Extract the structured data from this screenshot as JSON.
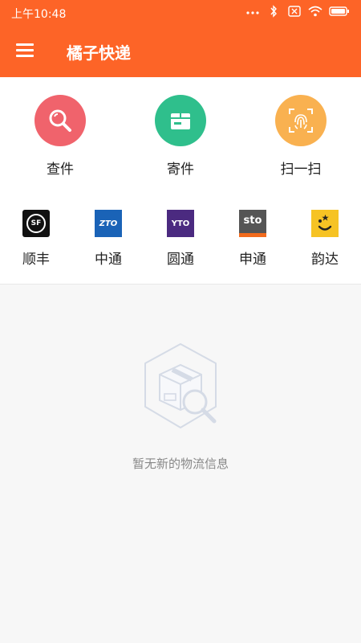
{
  "status_bar": {
    "time": "上午10:48",
    "icons": [
      "dots-icon",
      "bluetooth-icon",
      "sim-icon",
      "wifi-icon",
      "battery-icon"
    ]
  },
  "app_bar": {
    "title": "橘子快递",
    "menu_icon": "menu-icon"
  },
  "actions": [
    {
      "label": "查件",
      "icon": "search-icon",
      "color": "#f0636c"
    },
    {
      "label": "寄件",
      "icon": "package-icon",
      "color": "#2fbf8c"
    },
    {
      "label": "扫一扫",
      "icon": "fingerprint-scan-icon",
      "color": "#f9b150"
    }
  ],
  "couriers": [
    {
      "label": "顺丰",
      "logo_text": "SF",
      "color": "#111111"
    },
    {
      "label": "中通",
      "logo_text": "ZTO",
      "color": "#1a63b7"
    },
    {
      "label": "圆通",
      "logo_text": "YTO",
      "color": "#4b2a80"
    },
    {
      "label": "申通",
      "logo_text": "sto",
      "color": "#555555"
    },
    {
      "label": "韵达",
      "logo_text": "",
      "color": "#f6c324"
    }
  ],
  "empty_state": {
    "message": "暂无新的物流信息",
    "icon": "empty-box-search-icon"
  },
  "colors": {
    "brand": "#fd6427",
    "background": "#f7f7f7"
  }
}
